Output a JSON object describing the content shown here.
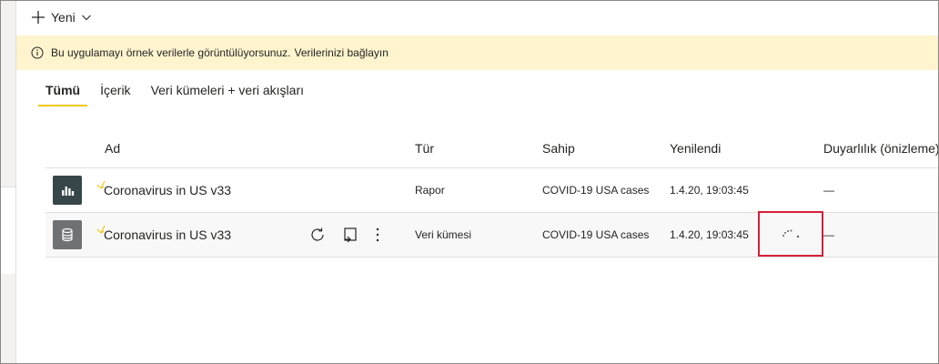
{
  "toolbar": {
    "new_label": "Yeni"
  },
  "banner": {
    "text": "Bu uygulamayı örnek verilerle görüntülüyorsunuz.",
    "link": "Verilerinizi bağlayın"
  },
  "tabs": [
    {
      "label": "Tümü",
      "active": true
    },
    {
      "label": "İçerik",
      "active": false
    },
    {
      "label": "Veri kümeleri + veri akışları",
      "active": false
    }
  ],
  "table": {
    "columns": [
      "Ad",
      "Tür",
      "Sahip",
      "Yenilendi",
      "Duyarlılık (önizleme)"
    ],
    "rows": [
      {
        "icon": "report-icon",
        "name": "Coronavirus in US v33",
        "type": "Rapor",
        "owner": "COVID-19 USA cases",
        "refreshed": "1.4.20, 19:03:45",
        "sensitivity": "—"
      },
      {
        "icon": "dataset-icon",
        "name": "Coronavirus in US v33",
        "type": "Veri kümesi",
        "owner": "COVID-19 USA cases",
        "refreshed": "1.4.20, 19:03:45",
        "sensitivity": "—"
      }
    ]
  },
  "colors": {
    "banner_bg": "#fff4ce",
    "tab_underline": "#f2c811",
    "highlight_box": "#d6203a",
    "report_tile": "#374649",
    "dataset_tile": "#6e7275"
  }
}
